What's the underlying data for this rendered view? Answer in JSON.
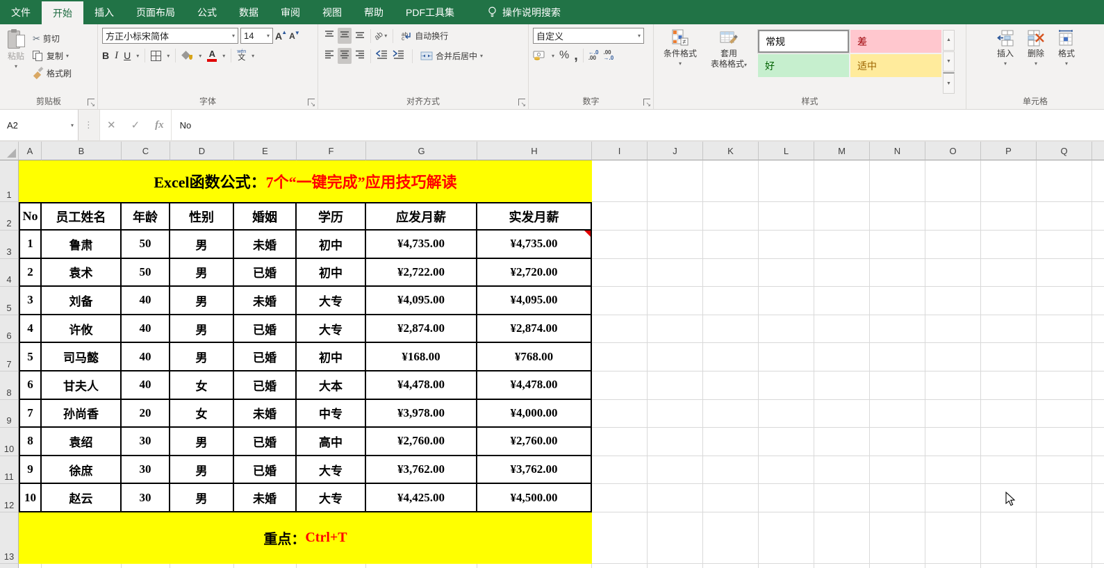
{
  "tabs": {
    "items": [
      {
        "label": "文件"
      },
      {
        "label": "开始",
        "active": true
      },
      {
        "label": "插入"
      },
      {
        "label": "页面布局"
      },
      {
        "label": "公式"
      },
      {
        "label": "数据"
      },
      {
        "label": "审阅"
      },
      {
        "label": "视图"
      },
      {
        "label": "帮助"
      },
      {
        "label": "PDF工具集"
      }
    ],
    "search_label": "操作说明搜索"
  },
  "ribbon": {
    "clipboard": {
      "group_label": "剪贴板",
      "paste": "粘贴",
      "cut": "剪切",
      "copy": "复制",
      "format_painter": "格式刷"
    },
    "font": {
      "group_label": "字体",
      "font_name": "方正小标宋简体",
      "font_size": "14",
      "bold": "B",
      "italic": "I",
      "underline": "U",
      "phonetic_small": "wén",
      "phonetic": "文"
    },
    "alignment": {
      "group_label": "对齐方式",
      "wrap_text": "自动换行",
      "merge_center": "合并后居中"
    },
    "number": {
      "group_label": "数字",
      "format": "自定义",
      "percent": "%",
      "comma": ",",
      "inc_dec_top": "←.0",
      "inc_dec_bottom": ".00",
      "dec_dec_top": ".00",
      "dec_dec_bottom": "→.0"
    },
    "styles": {
      "group_label": "样式",
      "conditional": "条件格式",
      "format_table_line1": "套用",
      "format_table_line2": "表格格式",
      "gallery": [
        {
          "label": "常规",
          "bg": "#ffffff",
          "fg": "#000000",
          "selected": true
        },
        {
          "label": "差",
          "bg": "#ffc7ce",
          "fg": "#9c0006",
          "selected": false
        },
        {
          "label": "好",
          "bg": "#c6efce",
          "fg": "#006100",
          "selected": false
        },
        {
          "label": "适中",
          "bg": "#ffeb9c",
          "fg": "#9c6500",
          "selected": false
        }
      ]
    },
    "cells": {
      "group_label": "单元格",
      "insert": "插入",
      "delete": "删除",
      "format": "格式"
    }
  },
  "formula_bar": {
    "name_box": "A2",
    "content": "No"
  },
  "sheet": {
    "columns": [
      "A",
      "B",
      "C",
      "D",
      "E",
      "F",
      "G",
      "H",
      "I",
      "J",
      "K",
      "L",
      "M",
      "N",
      "O",
      "P",
      "Q"
    ],
    "row_numbers": [
      "1",
      "2",
      "3",
      "4",
      "5",
      "6",
      "7",
      "8",
      "9",
      "10",
      "11",
      "12",
      "13"
    ],
    "title": {
      "prefix": "Excel函数公式：",
      "highlight": "7个“一键完成”应用技巧解读"
    },
    "footer": {
      "prefix": "重点：",
      "highlight": "Ctrl+T"
    },
    "table": {
      "headers": [
        "No",
        "员工姓名",
        "年龄",
        "性别",
        "婚姻",
        "学历",
        "应发月薪",
        "实发月薪"
      ],
      "rows": [
        [
          "1",
          "鲁肃",
          "50",
          "男",
          "未婚",
          "初中",
          "¥4,735.00",
          "¥4,735.00"
        ],
        [
          "2",
          "袁术",
          "50",
          "男",
          "已婚",
          "初中",
          "¥2,722.00",
          "¥2,720.00"
        ],
        [
          "3",
          "刘备",
          "40",
          "男",
          "未婚",
          "大专",
          "¥4,095.00",
          "¥4,095.00"
        ],
        [
          "4",
          "许攸",
          "40",
          "男",
          "已婚",
          "大专",
          "¥2,874.00",
          "¥2,874.00"
        ],
        [
          "5",
          "司马懿",
          "40",
          "男",
          "已婚",
          "初中",
          "¥168.00",
          "¥768.00"
        ],
        [
          "6",
          "甘夫人",
          "40",
          "女",
          "已婚",
          "大本",
          "¥4,478.00",
          "¥4,478.00"
        ],
        [
          "7",
          "孙尚香",
          "20",
          "女",
          "未婚",
          "中专",
          "¥3,978.00",
          "¥4,000.00"
        ],
        [
          "8",
          "袁绍",
          "30",
          "男",
          "已婚",
          "高中",
          "¥2,760.00",
          "¥2,760.00"
        ],
        [
          "9",
          "徐庶",
          "30",
          "男",
          "已婚",
          "大专",
          "¥3,762.00",
          "¥3,762.00"
        ],
        [
          "10",
          "赵云",
          "30",
          "男",
          "未婚",
          "大专",
          "¥4,425.00",
          "¥4,500.00"
        ]
      ],
      "comment_marker": {
        "row": 0,
        "col": 7
      }
    },
    "colors": {
      "banner_bg": "#ffff00",
      "accent_red": "#ff0000",
      "tab_green": "#217346"
    }
  }
}
